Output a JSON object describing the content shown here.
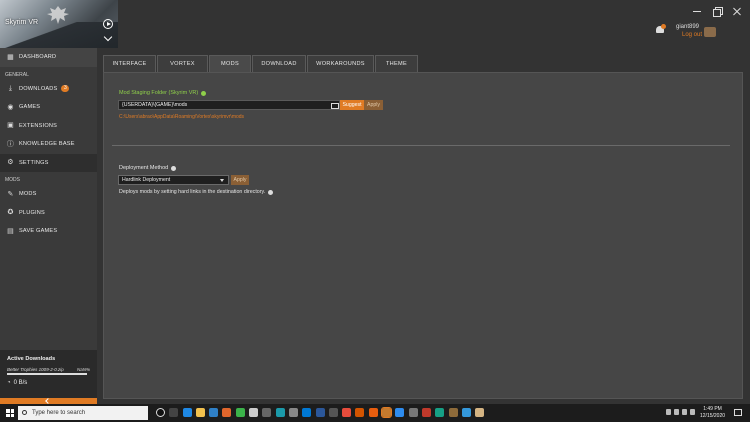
{
  "game": {
    "title": "Skyrim VR"
  },
  "user": {
    "name": "giant899",
    "logout_label": "Log out"
  },
  "sidebar": {
    "dashboard": "DASHBOARD",
    "general_header": "GENERAL",
    "downloads": "DOWNLOADS",
    "downloads_badge": "3",
    "games": "GAMES",
    "extensions": "EXTENSIONS",
    "knowledge_base": "KNOWLEDGE BASE",
    "settings": "SETTINGS",
    "mods_header": "MODS",
    "mods": "MODS",
    "plugins": "PLUGINS",
    "save_games": "SAVE GAMES"
  },
  "active_downloads": {
    "title": "Active Downloads",
    "file": "Better Trophies 1009-2-0.zip",
    "status": "NaN%",
    "speed": "0 B/s"
  },
  "tabs": [
    "INTERFACE",
    "VORTEX",
    "MODS",
    "DOWNLOAD",
    "WORKAROUNDS",
    "THEME"
  ],
  "active_tab": "MODS",
  "staging": {
    "label": "Mod Staging Folder (Skyrim VR)",
    "value": "{USERDATA}\\{GAME}\\mods",
    "suggest_label": "Suggest",
    "apply_label": "Apply",
    "resolved_path": "C:\\Users\\abrao\\AppData\\Roaming\\Vortex\\skyrimvr\\mods"
  },
  "deployment": {
    "label": "Deployment Method",
    "selected": "Hardlink Deployment",
    "apply_label": "Apply",
    "description": "Deploys mods by setting hard links in the destination directory."
  },
  "taskbar": {
    "search_placeholder": "Type here to search",
    "time": "1:49 PM",
    "date": "12/15/2020"
  },
  "colors": {
    "accent": "#e07b24",
    "success": "#8fcf4a"
  }
}
